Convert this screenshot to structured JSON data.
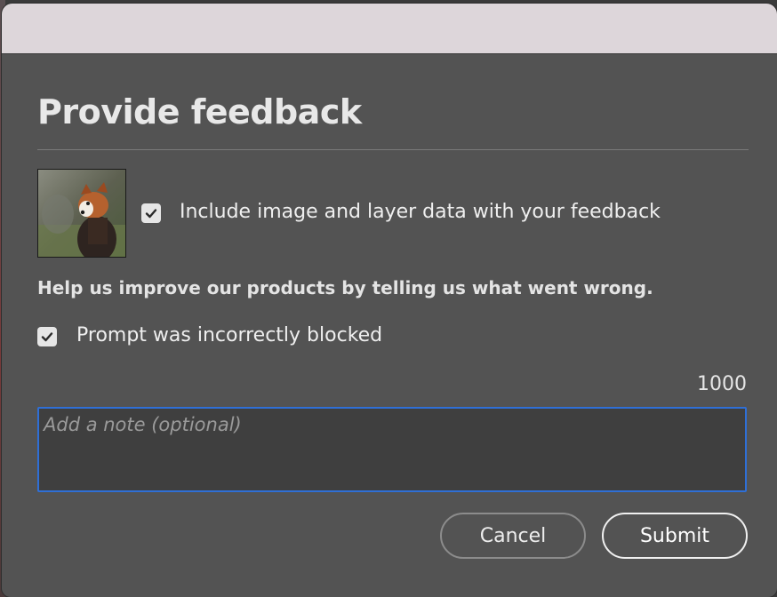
{
  "dialog": {
    "title": "Provide feedback",
    "include_data": {
      "label": "Include image and layer data with your feedback",
      "checked": true
    },
    "help_text": "Help us improve our products by telling us what went wrong.",
    "reason": {
      "label": "Prompt was incorrectly blocked",
      "checked": true
    },
    "char_limit": "1000",
    "note": {
      "placeholder": "Add a note (optional)",
      "value": ""
    },
    "buttons": {
      "cancel": "Cancel",
      "submit": "Submit"
    }
  },
  "icons": {
    "checkbox_check": "check-icon",
    "thumbnail": "red-panda-image"
  },
  "colors": {
    "dialog_bg": "#535353",
    "titlebar_bg": "#ddd6da",
    "focus_border": "#2f6fd6",
    "text": "#efefef"
  }
}
